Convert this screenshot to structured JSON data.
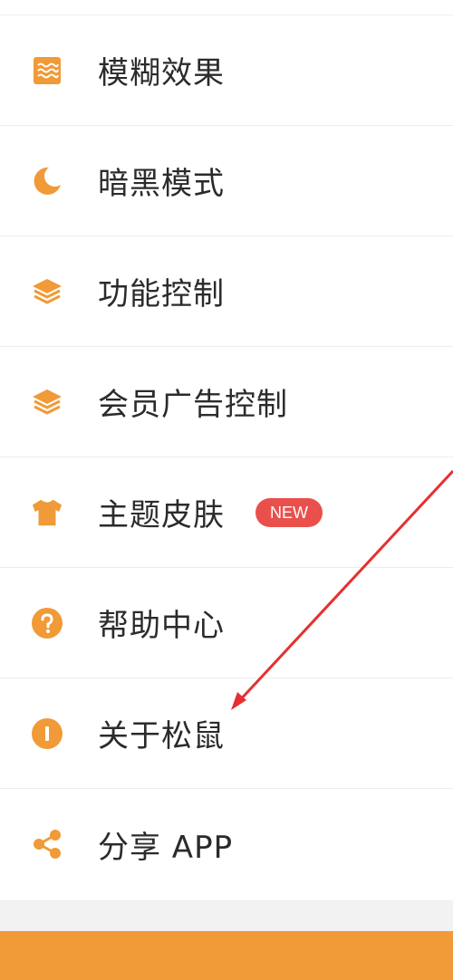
{
  "accent_color": "#f09a38",
  "badge_color": "#e9504c",
  "annotation_arrow_color": "#e53030",
  "menu": {
    "items": [
      {
        "label": "模糊效果",
        "icon": "blur-effect-icon"
      },
      {
        "label": "暗黑模式",
        "icon": "moon-icon"
      },
      {
        "label": "功能控制",
        "icon": "layers-icon"
      },
      {
        "label": "会员广告控制",
        "icon": "layers-icon"
      },
      {
        "label": "主题皮肤",
        "icon": "tshirt-icon",
        "badge": "NEW"
      },
      {
        "label": "帮助中心",
        "icon": "question-circle-icon"
      },
      {
        "label": "关于松鼠",
        "icon": "info-circle-icon"
      },
      {
        "label": "分享 APP",
        "icon": "share-icon"
      }
    ]
  }
}
